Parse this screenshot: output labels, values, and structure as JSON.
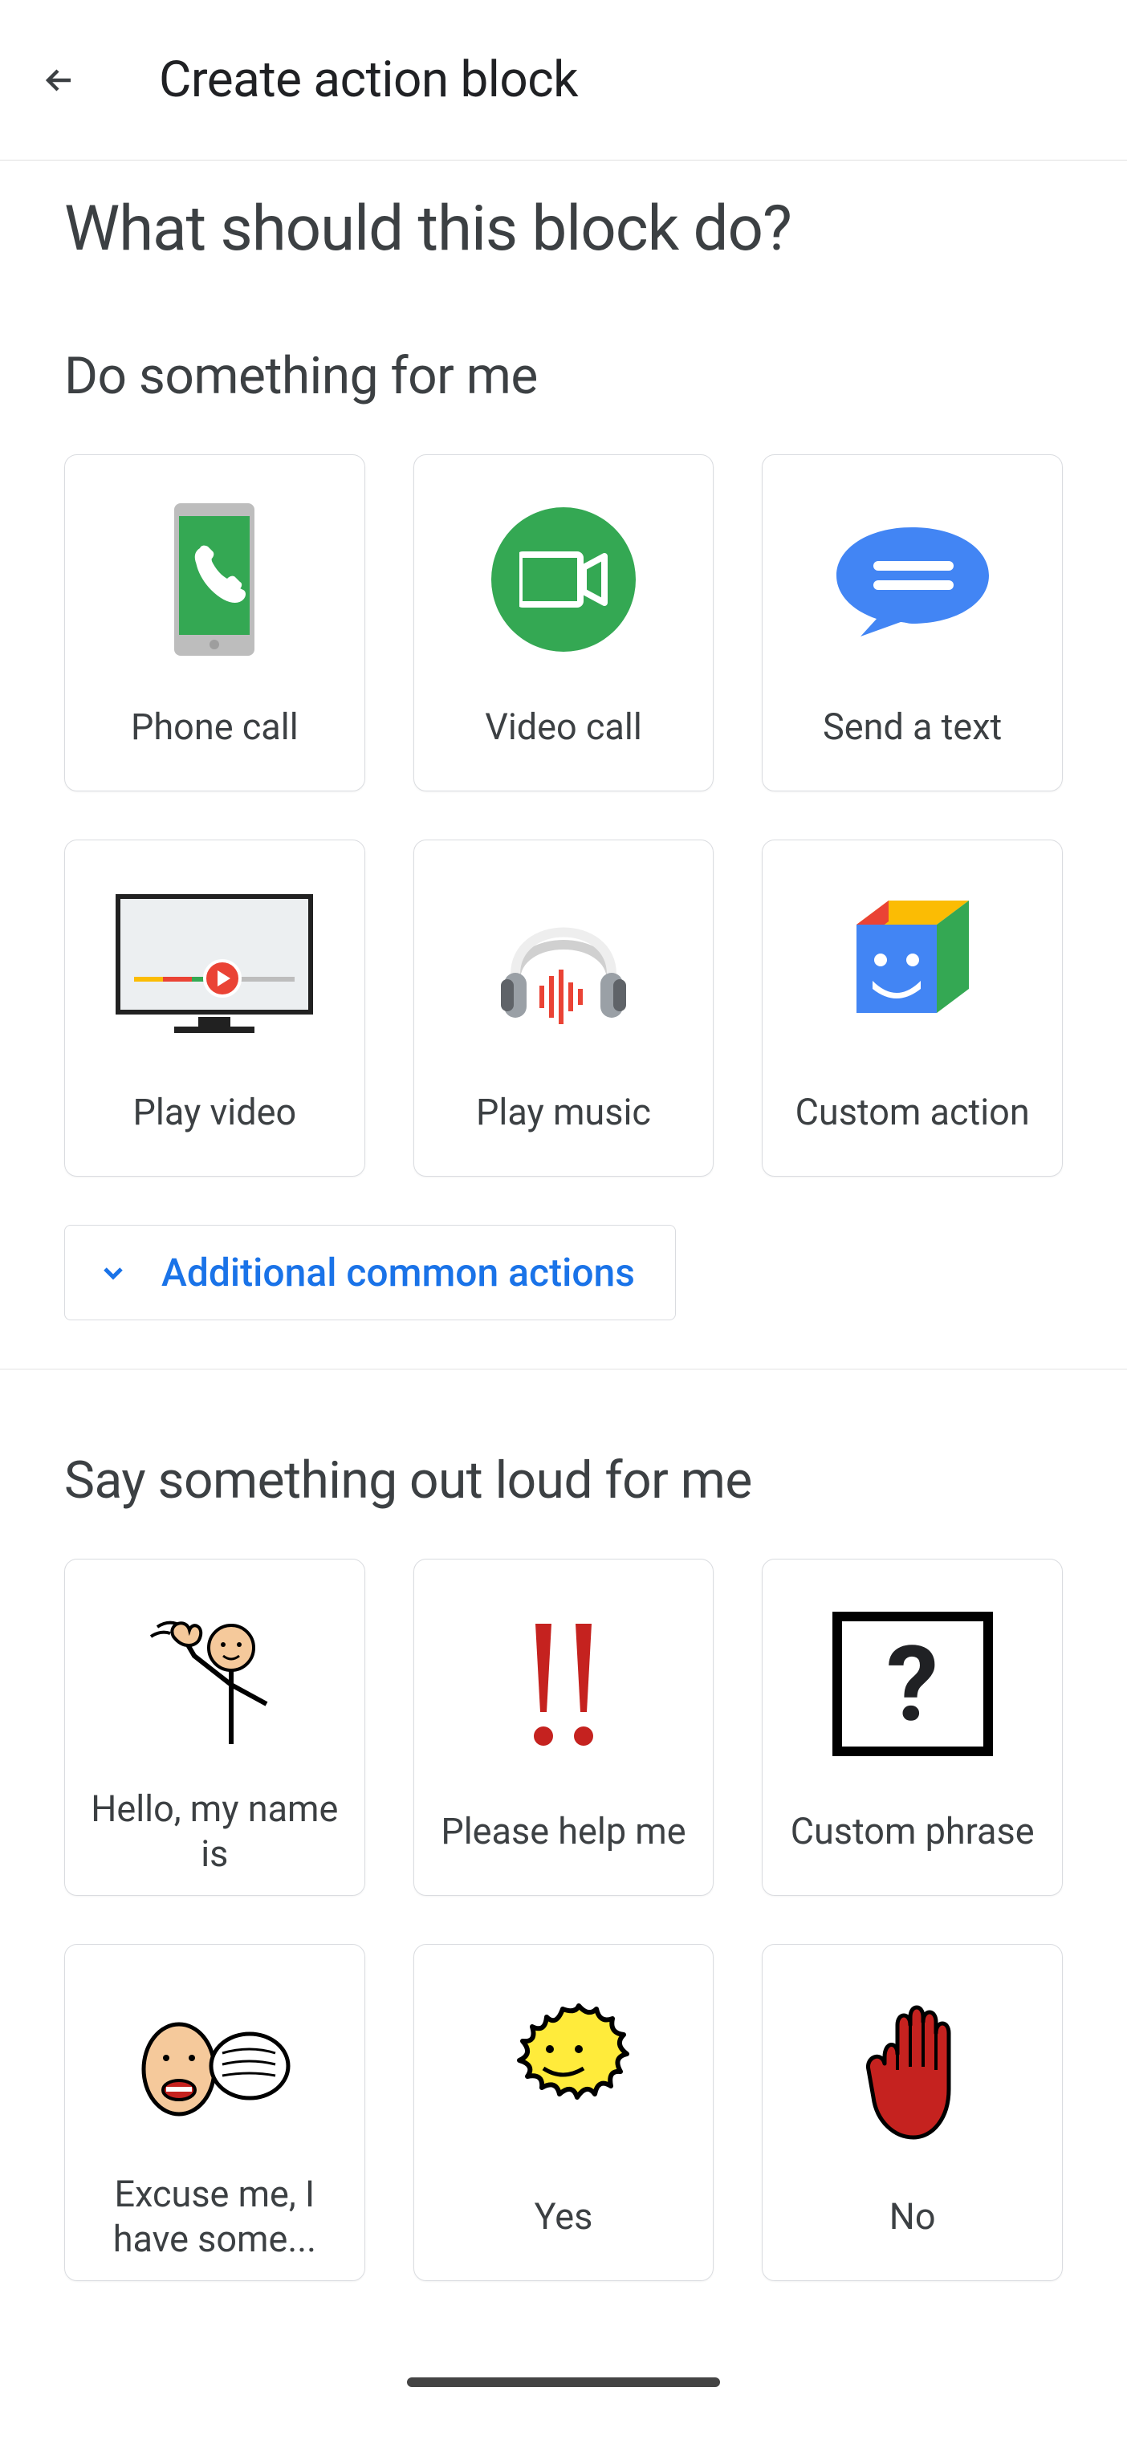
{
  "header": {
    "title": "Create action block"
  },
  "question": "What should this block do?",
  "sections": {
    "do": {
      "title": "Do something for me",
      "cards": [
        {
          "label": "Phone call"
        },
        {
          "label": "Video call"
        },
        {
          "label": "Send a text"
        },
        {
          "label": "Play video"
        },
        {
          "label": "Play music"
        },
        {
          "label": "Custom action"
        }
      ],
      "expand": "Additional common actions"
    },
    "say": {
      "title": "Say something out loud for me",
      "cards": [
        {
          "label": "Hello, my name is"
        },
        {
          "label": "Please help me"
        },
        {
          "label": "Custom phrase"
        },
        {
          "label": "Excuse me, I have some..."
        },
        {
          "label": "Yes"
        },
        {
          "label": "No"
        }
      ]
    }
  }
}
